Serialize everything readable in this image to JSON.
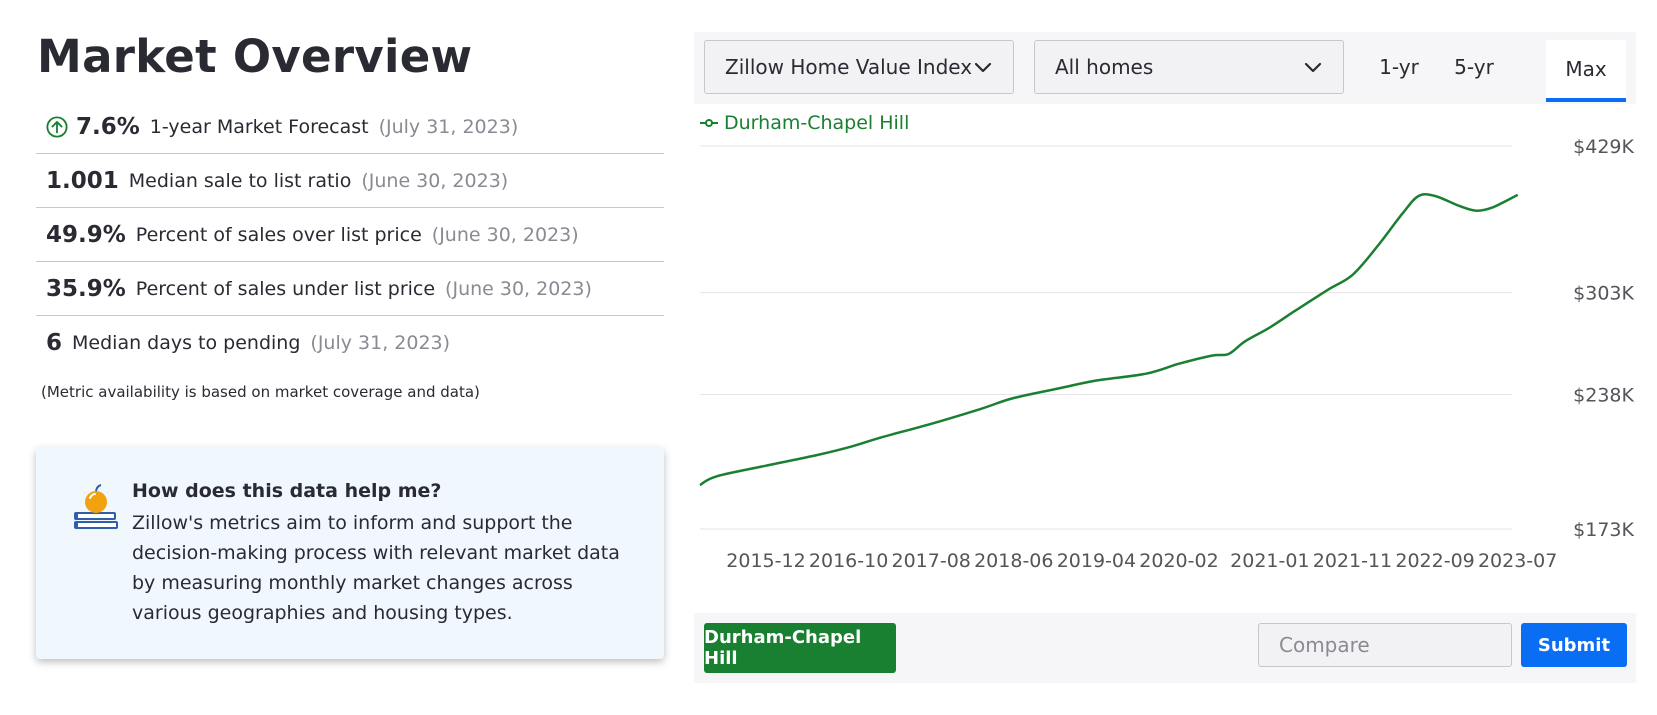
{
  "page": {
    "title": "Market Overview"
  },
  "metrics": [
    {
      "value": "7.6%",
      "label": "1-year Market Forecast",
      "date": "(July 31, 2023)",
      "icon": "arrow-up-circle-icon"
    },
    {
      "value": "1.001",
      "label": "Median sale to list ratio",
      "date": "(June 30, 2023)"
    },
    {
      "value": "49.9%",
      "label": "Percent of sales over list price",
      "date": "(June 30, 2023)"
    },
    {
      "value": "35.9%",
      "label": "Percent of sales under list price",
      "date": "(June 30, 2023)"
    },
    {
      "value": "6",
      "label": "Median days to pending",
      "date": "(July 31, 2023)"
    }
  ],
  "note": "(Metric availability is based on market coverage and data)",
  "help": {
    "icon": "apple-books-icon",
    "title": "How does this data help me?",
    "body": "Zillow's metrics aim to inform and support the decision-making process with relevant market data by measuring monthly market changes across various geographies and housing types."
  },
  "controls": {
    "metric_select": "Zillow Home Value Index",
    "home_type_select": "All homes",
    "ranges": [
      "1-yr",
      "5-yr",
      "Max"
    ],
    "active_range": "Max"
  },
  "legend": {
    "series_name": "Durham-Chapel Hill",
    "color": "#1a8031"
  },
  "bottom": {
    "region_chip": "Durham-Chapel Hill",
    "compare_placeholder": "Compare",
    "submit_label": "Submit"
  },
  "colors": {
    "accent": "#0a6ef5",
    "series": "#1a8031"
  },
  "chart_data": {
    "type": "line",
    "series": [
      {
        "name": "Durham-Chapel Hill",
        "x": [
          "2015-01",
          "2015-06",
          "2015-12",
          "2016-06",
          "2016-10",
          "2017-02",
          "2017-08",
          "2018-02",
          "2018-06",
          "2018-12",
          "2019-04",
          "2019-10",
          "2020-02",
          "2020-06",
          "2020-08",
          "2020-10",
          "2021-01",
          "2021-04",
          "2021-08",
          "2021-11",
          "2022-02",
          "2022-05",
          "2022-07",
          "2022-09",
          "2022-12",
          "2023-02",
          "2023-04",
          "2023-07"
        ],
        "values": [
          192,
          196,
          201,
          206,
          210,
          215,
          222,
          230,
          236,
          242,
          246,
          250,
          256,
          261,
          262,
          270,
          279,
          290,
          305,
          316,
          338,
          365,
          381,
          381,
          372,
          368,
          371,
          382
        ]
      }
    ],
    "x_tick_labels": [
      "2015-12",
      "2016-10",
      "2017-08",
      "2018-06",
      "2019-04",
      "2020-02",
      "2021-01",
      "2021-11",
      "2022-09",
      "2023-07"
    ],
    "y_tick_labels": [
      "$429K",
      "$303K",
      "$238K",
      "$173K"
    ],
    "y_scale": "log",
    "ylim": [
      173,
      429
    ],
    "grid": true,
    "legend_position": "top-left"
  }
}
